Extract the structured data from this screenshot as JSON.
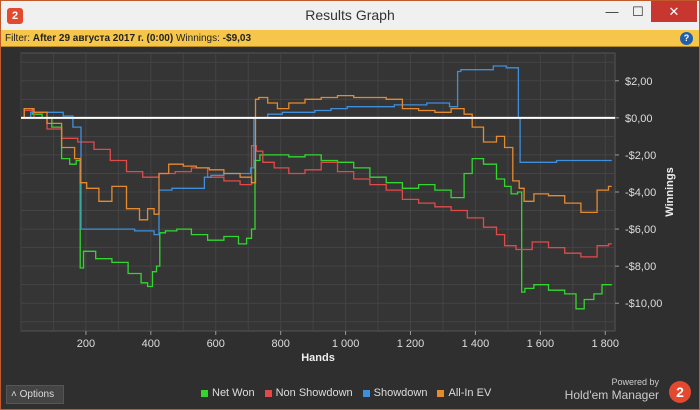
{
  "window": {
    "title": "Results Graph",
    "app_icon": "2",
    "minimize": "—",
    "maximize": "☐",
    "close": "✕"
  },
  "filter": {
    "prefix": "Filter:",
    "value": "After 29 августа 2017 г. (0:00)",
    "winnings_label": "Winnings:",
    "winnings_value": "-$9,03",
    "help": "?"
  },
  "options_label": "Options",
  "options_caret": "˄",
  "brand": {
    "powered": "Powered by",
    "name": "Hold'em Manager",
    "logo": "2"
  },
  "colors": {
    "net_won": "#33d62f",
    "non_showdown": "#e24a4a",
    "showdown": "#3f8fdc",
    "all_in_ev": "#e68a2e",
    "zero_line": "#ffffff"
  },
  "chart_data": {
    "type": "line",
    "xlabel": "Hands",
    "ylabel": "Winnings",
    "xlim": [
      0,
      1830
    ],
    "ylim": [
      -11.5,
      3.5
    ],
    "x_ticks": [
      200,
      400,
      600,
      800,
      1000,
      1200,
      1400,
      1600,
      1800
    ],
    "x_tick_labels": [
      "200",
      "400",
      "600",
      "800",
      "1 000",
      "1 200",
      "1 400",
      "1 600",
      "1 800"
    ],
    "y_ticks": [
      2,
      0,
      -2,
      -4,
      -6,
      -8,
      -10
    ],
    "y_tick_labels": [
      "$2,00",
      "$0,00",
      "-$2,00",
      "-$4,00",
      "-$6,00",
      "-$8,00",
      "-$10,00"
    ],
    "legend_position": "bottom",
    "grid": true,
    "series": [
      {
        "name": "Net Won",
        "color": "#33d62f",
        "x": [
          0,
          20,
          50,
          80,
          110,
          140,
          160,
          180,
          185,
          200,
          260,
          300,
          360,
          380,
          400,
          410,
          425,
          430,
          460,
          500,
          550,
          600,
          650,
          690,
          700,
          720,
          722,
          750,
          800,
          850,
          900,
          950,
          1000,
          1050,
          1100,
          1150,
          1200,
          1250,
          1300,
          1350,
          1380,
          1400,
          1450,
          1480,
          1500,
          1520,
          1540,
          1545,
          1560,
          1600,
          1650,
          1700,
          1720,
          1750,
          1780,
          1800,
          1820
        ],
        "y": [
          0,
          0.5,
          0.2,
          0,
          -0.5,
          -2.2,
          -2.5,
          -2.3,
          -8.1,
          -7.2,
          -7.6,
          -7.8,
          -8.4,
          -8.9,
          -9.1,
          -8.3,
          -8.0,
          -6.2,
          -6.1,
          -6.0,
          -6.3,
          -6.6,
          -6.4,
          -6.8,
          -6.5,
          -6.0,
          -2.3,
          -2.0,
          -2.0,
          -2.1,
          -2.0,
          -2.3,
          -2.4,
          -2.7,
          -3.2,
          -3.5,
          -3.8,
          -3.6,
          -3.9,
          -4.3,
          -3.0,
          -2.2,
          -2.5,
          -3.3,
          -3.7,
          -4.1,
          -4.0,
          -9.4,
          -9.2,
          -9.0,
          -9.3,
          -9.5,
          -10.3,
          -9.8,
          -9.5,
          -9.0,
          -9.0
        ]
      },
      {
        "name": "Non Showdown",
        "color": "#e24a4a",
        "x": [
          0,
          20,
          60,
          100,
          150,
          200,
          250,
          300,
          350,
          400,
          450,
          500,
          550,
          600,
          650,
          700,
          720,
          730,
          760,
          800,
          850,
          900,
          950,
          1000,
          1050,
          1100,
          1150,
          1200,
          1250,
          1300,
          1350,
          1400,
          1450,
          1480,
          1500,
          1550,
          1600,
          1650,
          1700,
          1750,
          1800,
          1820
        ],
        "y": [
          0,
          0.4,
          0,
          -0.6,
          -1.1,
          -1.3,
          -1.7,
          -2.3,
          -2.9,
          -3.2,
          -3.0,
          -2.9,
          -2.7,
          -3.2,
          -3.4,
          -3.6,
          -1.5,
          -1.8,
          -2.4,
          -2.7,
          -3.0,
          -2.8,
          -2.4,
          -2.9,
          -3.3,
          -3.6,
          -3.9,
          -4.4,
          -4.6,
          -4.8,
          -5.0,
          -5.4,
          -5.9,
          -6.3,
          -6.9,
          -7.1,
          -6.7,
          -7.0,
          -7.3,
          -7.5,
          -6.9,
          -6.8
        ]
      },
      {
        "name": "Showdown",
        "color": "#3f8fdc",
        "x": [
          0,
          60,
          120,
          140,
          180,
          190,
          250,
          300,
          400,
          420,
          430,
          500,
          560,
          570,
          600,
          650,
          700,
          715,
          720,
          800,
          810,
          900,
          910,
          1000,
          1010,
          1100,
          1200,
          1300,
          1340,
          1350,
          1360,
          1450,
          1460,
          1530,
          1535,
          1540,
          1600,
          1700,
          1800,
          1820
        ],
        "y": [
          0,
          0.3,
          0.3,
          0.1,
          -0.5,
          -6.0,
          -6.0,
          -6.0,
          -6.1,
          -6.3,
          -3.9,
          -3.8,
          -3.8,
          -3.2,
          -3.1,
          -3.0,
          -3.0,
          -2.7,
          0,
          0.2,
          0.3,
          0.3,
          0.4,
          0.5,
          0.6,
          0.6,
          0.7,
          0.8,
          0.6,
          2.5,
          2.6,
          2.6,
          2.8,
          2.7,
          0,
          -2.4,
          -2.4,
          -2.3,
          -2.3,
          -2.3
        ]
      },
      {
        "name": "All-In EV",
        "color": "#e68a2e",
        "x": [
          0,
          20,
          60,
          100,
          150,
          180,
          185,
          220,
          260,
          300,
          350,
          380,
          400,
          420,
          430,
          480,
          520,
          560,
          600,
          650,
          700,
          720,
          725,
          740,
          780,
          800,
          850,
          900,
          950,
          1000,
          1050,
          1100,
          1150,
          1200,
          1250,
          1300,
          1350,
          1380,
          1400,
          1450,
          1480,
          1500,
          1530,
          1540,
          1560,
          1600,
          1650,
          1700,
          1750,
          1800,
          1820
        ],
        "y": [
          0,
          0.5,
          0.3,
          -0.3,
          -1.6,
          -2.2,
          -3.5,
          -3.8,
          -4.5,
          -3.7,
          -4.9,
          -5.5,
          -4.9,
          -5.2,
          -3.0,
          -2.5,
          -2.6,
          -2.7,
          -2.8,
          -3.0,
          -3.2,
          -3.5,
          1.0,
          1.1,
          0.8,
          0.5,
          0.8,
          1.0,
          1.1,
          1.2,
          1.1,
          1.1,
          1.0,
          0.5,
          0.4,
          0.3,
          0.5,
          0.2,
          -0.5,
          -1.3,
          -1.0,
          -1.6,
          -3.4,
          -3.8,
          -4.5,
          -4.1,
          -4.2,
          -4.6,
          -5.1,
          -3.9,
          -3.7
        ]
      }
    ]
  }
}
